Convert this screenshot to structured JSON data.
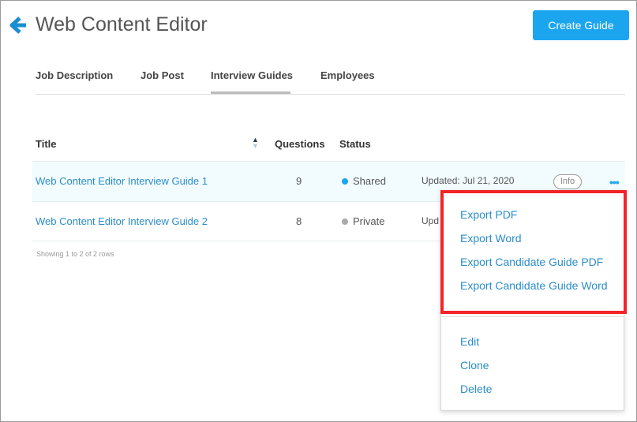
{
  "header": {
    "title": "Web Content Editor",
    "create_label": "Create Guide",
    "back_icon": "arrow-left-icon",
    "accent": "#1ba5ef"
  },
  "tabs": [
    {
      "label": "Job Description"
    },
    {
      "label": "Job Post"
    },
    {
      "label": "Interview Guides",
      "active": true
    },
    {
      "label": "Employees"
    }
  ],
  "table": {
    "columns": [
      "Title",
      "Questions",
      "Status"
    ],
    "rows": [
      {
        "title": "Web Content Editor Interview Guide 1",
        "questions": "9",
        "status": "Shared",
        "status_color": "#1ba5ef",
        "updated": "Updated:  Jul 21, 2020",
        "info": "Info"
      },
      {
        "title": "Web Content Editor Interview Guide 2",
        "questions": "8",
        "status": "Private",
        "status_color": "#aaaaaa",
        "updated": "Upd"
      }
    ],
    "footer": "Showing 1 to 2 of 2 rows"
  },
  "menu": {
    "export_items": [
      "Export PDF",
      "Export Word",
      "Export Candidate Guide PDF",
      "Export Candidate Guide Word"
    ],
    "items": [
      "Edit",
      "Clone",
      "Delete"
    ],
    "highlight_color": "#f2242a"
  }
}
